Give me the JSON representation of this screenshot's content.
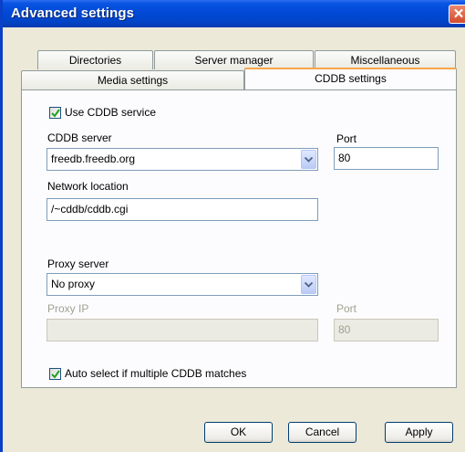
{
  "window": {
    "title": "Advanced settings",
    "close_glyph": "✕"
  },
  "tabs": {
    "row1": [
      "Directories",
      "Server manager",
      "Miscellaneous"
    ],
    "row2": [
      "Media settings",
      "CDDB settings"
    ],
    "active": "CDDB settings"
  },
  "cddb": {
    "use_service_label": "Use CDDB service",
    "use_service_checked": true,
    "server_label": "CDDB server",
    "server_value": "freedb.freedb.org",
    "port_label": "Port",
    "port_value": "80",
    "network_location_label": "Network location",
    "network_location_value": "/~cddb/cddb.cgi",
    "proxy_server_label": "Proxy server",
    "proxy_server_value": "No proxy",
    "proxy_ip_label": "Proxy IP",
    "proxy_ip_value": "",
    "proxy_port_label": "Port",
    "proxy_port_value": "80",
    "auto_select_label": "Auto select if multiple CDDB matches",
    "auto_select_checked": true
  },
  "buttons": {
    "ok": "OK",
    "cancel": "Cancel",
    "apply": "Apply"
  },
  "colors": {
    "title_bar": "#0149d6",
    "dialog_bg": "#ece9d8",
    "tab_highlight": "#f7a54a",
    "close_button": "#d24a2b"
  }
}
